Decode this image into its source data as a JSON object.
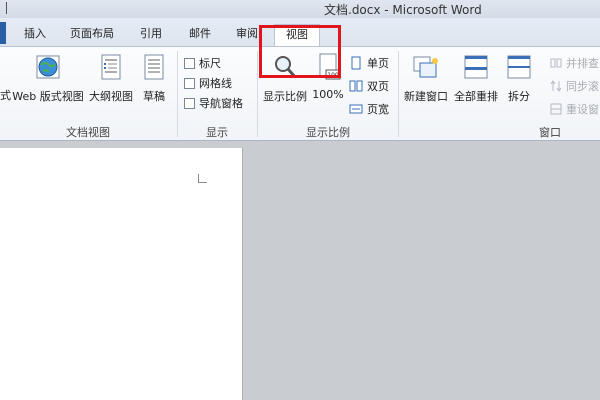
{
  "window": {
    "title": "文档.docx - Microsoft Word"
  },
  "tabs": [
    {
      "label": "插入"
    },
    {
      "label": "页面布局"
    },
    {
      "label": "引用"
    },
    {
      "label": "邮件"
    },
    {
      "label": "审阅"
    },
    {
      "label": "视图",
      "active": true
    }
  ],
  "ribbon": {
    "document_views": {
      "group_label": "文档视图",
      "partial_label": "式",
      "web_label": "Web 版式视图",
      "outline_label": "大纲视图",
      "draft_label": "草稿"
    },
    "show": {
      "group_label": "显示",
      "ruler_label": "标尺",
      "gridlines_label": "网格线",
      "navpane_label": "导航窗格"
    },
    "zoom": {
      "group_label": "显示比例",
      "zoom_label": "显示比例",
      "hundred_label": "100%",
      "one_page_label": "单页",
      "two_pages_label": "双页",
      "page_width_label": "页宽",
      "hundred_icon_text": "100"
    },
    "window": {
      "group_label": "窗口",
      "new_window_label": "新建窗口",
      "arrange_all_label": "全部重排",
      "split_label": "拆分",
      "side_by_side_label": "并排查",
      "sync_scroll_label": "同步滚",
      "reset_pos_label": "重设窗"
    }
  },
  "colors": {
    "highlight": "#e0161c",
    "accent": "#2c5ea8"
  }
}
